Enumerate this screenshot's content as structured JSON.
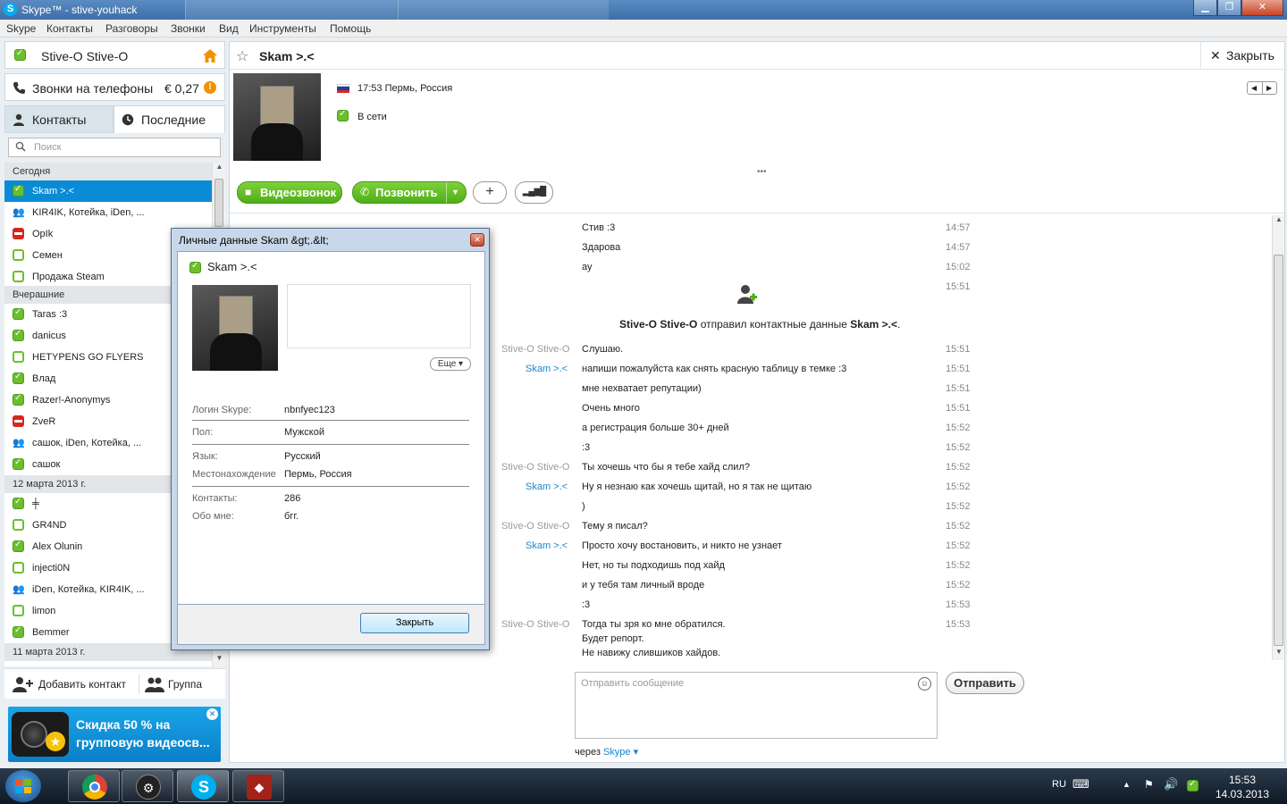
{
  "window": {
    "title": "Skype™ - stive-youhack",
    "buttons": {
      "minimize": "▁",
      "maximize": "❐",
      "close": "✕"
    }
  },
  "menu": [
    "Skype",
    "Контакты",
    "Разговоры",
    "Звонки",
    "Вид",
    "Инструменты",
    "Помощь"
  ],
  "profile": {
    "name": "Stive-O Stive-O"
  },
  "phone": {
    "label": "Звонки на телефоны",
    "credit": "€ 0,27",
    "badge": "!"
  },
  "tabs": {
    "contacts": "Контакты",
    "recent": "Последние"
  },
  "search": {
    "placeholder": "Поиск"
  },
  "groups": {
    "today": "Сегодня",
    "yesterday": "Вчерашние",
    "march12": "12 марта 2013 г.",
    "march11": "11 марта 2013 г."
  },
  "contacts": [
    {
      "name": "Skam >.<",
      "status": "online",
      "selected": true
    },
    {
      "name": "KIR4IK, Котейка, iDen, ...",
      "status": "group"
    },
    {
      "name": "OpIk",
      "status": "busy"
    },
    {
      "name": "Семен",
      "status": "offline"
    },
    {
      "name": "Продажа Steam",
      "status": "offline"
    },
    {
      "name": "Taras :3",
      "status": "online"
    },
    {
      "name": "danicus",
      "status": "online"
    },
    {
      "name": "HETYPENS GO FLYERS",
      "status": "offline"
    },
    {
      "name": "Влад",
      "status": "online"
    },
    {
      "name": "Razer!-Anonymys",
      "status": "online"
    },
    {
      "name": "ZveR",
      "status": "busy"
    },
    {
      "name": "сашок, iDen, Котейка, ...",
      "status": "group"
    },
    {
      "name": "сашок",
      "status": "online"
    },
    {
      "name": "╪",
      "status": "online"
    },
    {
      "name": "GR4ND",
      "status": "offline"
    },
    {
      "name": "Alex Olunin",
      "status": "online"
    },
    {
      "name": "injecti0N",
      "status": "offline"
    },
    {
      "name": "iDen, Котейка, KIR4IK, ...",
      "status": "group"
    },
    {
      "name": "limon",
      "status": "offline"
    },
    {
      "name": "Bemmer",
      "status": "online"
    }
  ],
  "bottom": {
    "add_contact": "Добавить контакт",
    "group": "Группа"
  },
  "promo": {
    "text": "Скидка 50 % на групповую видеосв..."
  },
  "conversation": {
    "name": "Skam >.<",
    "close_label": "Закрыть",
    "local_time": "17:53 Пермь, Россия",
    "status": "В сети",
    "video_label": "Видеозвонок",
    "call_label": "Позвонить",
    "add_label": "+",
    "signal_label": "▂▄▆█"
  },
  "messages": [
    {
      "sender": "",
      "text": "Стив :3",
      "time": "14:57"
    },
    {
      "sender": "",
      "text": "Здарова",
      "time": "14:57"
    },
    {
      "sender": "",
      "text": "ау",
      "time": "15:02"
    },
    {
      "sender": "",
      "text": "",
      "time": "15:51"
    },
    {
      "sender": "Stive-O Stive-O",
      "text": "Слушаю.",
      "time": "15:51"
    },
    {
      "sender": "Skam >.<",
      "text": "напиши пожалуйста как снять красную таблицу в темке :3",
      "time": "15:51"
    },
    {
      "sender": "",
      "text": "мне нехватает репутации)",
      "time": "15:51"
    },
    {
      "sender": "",
      "text": "Очень много",
      "time": "15:51"
    },
    {
      "sender": "",
      "text": "а регистрация больше 30+ дней",
      "time": "15:52"
    },
    {
      "sender": "",
      "text": " :3",
      "time": "15:52"
    },
    {
      "sender": "Stive-O Stive-O",
      "text": "Ты хочешь что бы я тебе хайд слил?",
      "time": "15:52"
    },
    {
      "sender": "Skam >.<",
      "text": "Ну я незнаю как хочешь щитай, но я так не щитаю",
      "time": "15:52"
    },
    {
      "sender": "",
      "text": ")",
      "time": "15:52"
    },
    {
      "sender": "Stive-O Stive-O",
      "text": "Тему я писал?",
      "time": "15:52"
    },
    {
      "sender": "Skam >.<",
      "text": "Просто хочу востановить, и никто не узнает",
      "time": "15:52"
    },
    {
      "sender": "",
      "text": "Нет, но ты подходишь под хайд",
      "time": "15:52"
    },
    {
      "sender": "",
      "text": "и  у тебя там личный вроде",
      "time": "15:52"
    },
    {
      "sender": "",
      "text": ":3",
      "time": "15:53"
    },
    {
      "sender": "Stive-O Stive-O",
      "text": "Тогда ты зря ко мне обратился.",
      "time": "15:53"
    },
    {
      "sender": "",
      "text": "Будет репорт.",
      "time": ""
    },
    {
      "sender": "",
      "text": "Не навижу слившиков хайдов.",
      "time": ""
    }
  ],
  "system_message": {
    "actor": "Stive-O Stive-O",
    "action": " отправил контактные данные ",
    "target": "Skam >.<",
    "end": "."
  },
  "compose": {
    "placeholder": "Отправить сообщение",
    "send_label": "Отправить",
    "via_label": "через ",
    "via_link": "Skype ▾",
    "emoji": "☺"
  },
  "dialog": {
    "title": "Личные данные Skam &gt;.&lt;",
    "name": "Skam >.<",
    "more": "Еще ▾",
    "fields": [
      {
        "label": "Логин Skype:",
        "value": "nbnfyec123"
      },
      {
        "label": "Пол:",
        "value": "Мужской"
      },
      {
        "label": "Язык:",
        "value": "Русский"
      },
      {
        "label": "Местонахождение",
        "value": "Пермь, Россия"
      },
      {
        "label": "Контакты:",
        "value": "286"
      },
      {
        "label": "Обо мне:",
        "value": "бгг."
      }
    ],
    "close_button": "Закрыть"
  },
  "taskbar": {
    "lang": "RU",
    "time": "15:53",
    "date": "14.03.2013"
  },
  "colors": {
    "accent": "#0a8bd6",
    "online": "#6cbf2c",
    "busy": "#d9261c",
    "link": "#1a86cc"
  }
}
